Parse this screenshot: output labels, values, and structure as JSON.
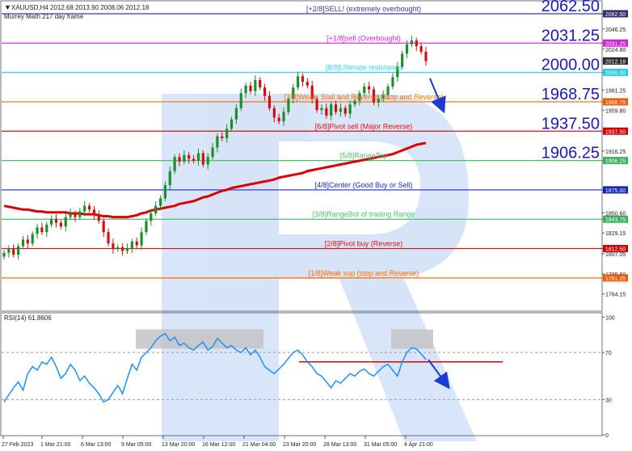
{
  "header": {
    "symbol_line": "XAUUSD,H4  2012.68 2013.90 2008.06 2012.18",
    "indicator_name": "Murrey Math 217 day frame"
  },
  "chart_data": {
    "type": "candlestick",
    "symbol": "XAUUSD",
    "timeframe": "H4",
    "ohlc_header": {
      "open": 2012.68,
      "high": 2013.9,
      "low": 2008.06,
      "close": 2012.18
    },
    "current_price": 2012.18,
    "y_ticks": [
      2062.5,
      2046.25,
      2031.25,
      2024.8,
      2012.18,
      2000.0,
      1981.25,
      1968.75,
      1959.8,
      1937.5,
      1916.25,
      1906.25,
      1875.0,
      1850.6,
      1843.75,
      1829.15,
      1812.5,
      1807.05,
      1785.6,
      1781.25,
      1764.15
    ],
    "y_tick_labels": [
      "2062.50",
      "2046.25",
      "2031.25",
      "2024.80",
      "2012.18",
      "2000.00",
      "1981.25",
      "1968.75",
      "1959.80",
      "1937.50",
      "1916.25",
      "1906.25",
      "1875.00",
      "1850.60",
      "1843.75",
      "1829.15",
      "1812.50",
      "1807.05",
      "1785.60",
      "1781.25",
      "1764.15"
    ],
    "ylim": [
      1758,
      2073
    ],
    "x_ticks": [
      "27 Feb 2023",
      "1 Mar 21:00",
      "6 Mar 13:00",
      "9 Mar 05:00",
      "13 Mar 20:00",
      "16 Mar 12:00",
      "21 Mar 04:00",
      "23 Mar 20:00",
      "28 Mar 13:00",
      "31 Mar 05:00",
      "4 Apr 21:00"
    ],
    "murrey_levels": [
      {
        "value": 2062.5,
        "label": "[+2/8]SELL! (extremely overbought)",
        "color": "#3a3aa0",
        "badge_color": "#2e2e6e"
      },
      {
        "value": 2031.25,
        "label": "[+1/8]sell (Overbought)",
        "color": "#e020e0",
        "badge_color": "#d51fd5"
      },
      {
        "value": 2000.0,
        "label": "[8/8]Ultimate resistance",
        "color": "#33d6ee",
        "badge_color": "#2ac8e0"
      },
      {
        "value": 1968.75,
        "label": "[7/8]Weak, Stall and Reverse (Stop and Reverse)",
        "color": "#ff6a00",
        "badge_color": "#f05a00"
      },
      {
        "value": 1937.5,
        "label": "[6/8]Pivot sell (Major Reverse)",
        "color": "#e01010",
        "badge_color": "#d00000"
      },
      {
        "value": 1906.25,
        "label": "[5/8]RangeTop",
        "color": "#4cbf6c",
        "badge_color": "#3fae5c"
      },
      {
        "value": 1875.0,
        "label": "[4/8]Center (Good Buy or Sell)",
        "color": "#1a2bd0",
        "badge_color": "#1421b8"
      },
      {
        "value": 1843.75,
        "label": "[3/8]RangeBot of trading Range",
        "color": "#4cbf6c",
        "badge_color": "#3fae5c"
      },
      {
        "value": 1812.5,
        "label": "[2/8]Pivot buy (Reverse)",
        "color": "#e01010",
        "badge_color": "#d00000"
      },
      {
        "value": 1781.25,
        "label": "[1/8]Weak sup (stop and Reverse)",
        "color": "#ff6a00",
        "badge_color": "#f05a00"
      }
    ],
    "big_labels": [
      {
        "value": 2062.5,
        "text": "2062.50"
      },
      {
        "value": 2031.25,
        "text": "2031.25"
      },
      {
        "value": 2000.0,
        "text": "2000.00"
      },
      {
        "value": 1968.75,
        "text": "1968.75"
      },
      {
        "value": 1937.5,
        "text": "1937.50"
      },
      {
        "value": 1906.25,
        "text": "1906.25"
      }
    ],
    "close_series": [
      1808,
      1812,
      1806,
      1815,
      1822,
      1818,
      1828,
      1835,
      1830,
      1838,
      1844,
      1840,
      1836,
      1846,
      1850,
      1846,
      1852,
      1858,
      1854,
      1848,
      1842,
      1830,
      1818,
      1812,
      1814,
      1810,
      1813,
      1820,
      1816,
      1830,
      1842,
      1850,
      1858,
      1866,
      1880,
      1895,
      1910,
      1905,
      1912,
      1908,
      1906,
      1914,
      1902,
      1910,
      1920,
      1932,
      1930,
      1940,
      1950,
      1962,
      1978,
      1986,
      1980,
      1992,
      1984,
      1975,
      1962,
      1952,
      1948,
      1958,
      1972,
      1984,
      1996,
      1990,
      1986,
      1972,
      1960,
      1962,
      1954,
      1966,
      1958,
      1962,
      1956,
      1966,
      1970,
      1978,
      1985,
      1982,
      1968,
      1972,
      1976,
      1985,
      1995,
      2006,
      2020,
      2030,
      2034,
      2028,
      2022,
      2012
    ],
    "ma_series": [
      1858,
      1857,
      1856,
      1855,
      1854,
      1854,
      1853,
      1852,
      1852,
      1851,
      1851,
      1851,
      1851,
      1851,
      1850,
      1850,
      1850,
      1849,
      1849,
      1849,
      1848,
      1847,
      1847,
      1846,
      1846,
      1846,
      1846,
      1847,
      1848,
      1850,
      1851,
      1853,
      1854,
      1855,
      1856,
      1857,
      1858,
      1860,
      1861,
      1862,
      1863,
      1865,
      1867,
      1868,
      1870,
      1872,
      1874,
      1875,
      1877,
      1878,
      1879,
      1880,
      1881,
      1882,
      1883,
      1884,
      1885,
      1886,
      1888,
      1889,
      1890,
      1891,
      1892,
      1893,
      1895,
      1896,
      1897,
      1898,
      1899,
      1900,
      1901,
      1902,
      1903,
      1904,
      1905,
      1906,
      1907,
      1908,
      1909,
      1910,
      1911,
      1912,
      1913,
      1915,
      1917,
      1919,
      1921,
      1923,
      1924,
      1925
    ],
    "forecast": {
      "direction": "down"
    },
    "rsi": {
      "label": "RSI(14) 61.8606",
      "value": 61.8606,
      "ylim": [
        0,
        100
      ],
      "y_ticks": [
        100,
        70,
        30,
        0
      ],
      "level_line": 62,
      "series": [
        28,
        34,
        40,
        45,
        38,
        52,
        58,
        55,
        62,
        60,
        66,
        58,
        48,
        52,
        60,
        55,
        46,
        50,
        44,
        40,
        35,
        28,
        30,
        36,
        42,
        35,
        48,
        60,
        55,
        66,
        70,
        74,
        80,
        84,
        86,
        80,
        83,
        76,
        78,
        74,
        72,
        76,
        79,
        72,
        75,
        82,
        78,
        74,
        76,
        72,
        70,
        74,
        68,
        72,
        66,
        58,
        55,
        52,
        56,
        60,
        65,
        70,
        72,
        68,
        62,
        58,
        52,
        50,
        45,
        40,
        46,
        44,
        48,
        52,
        50,
        54,
        56,
        52,
        50,
        54,
        58,
        60,
        55,
        50,
        62,
        70,
        74,
        73,
        69,
        64
      ]
    },
    "highlight_boxes": [
      "overbought zone mid-March",
      "overbought zone early April"
    ]
  }
}
